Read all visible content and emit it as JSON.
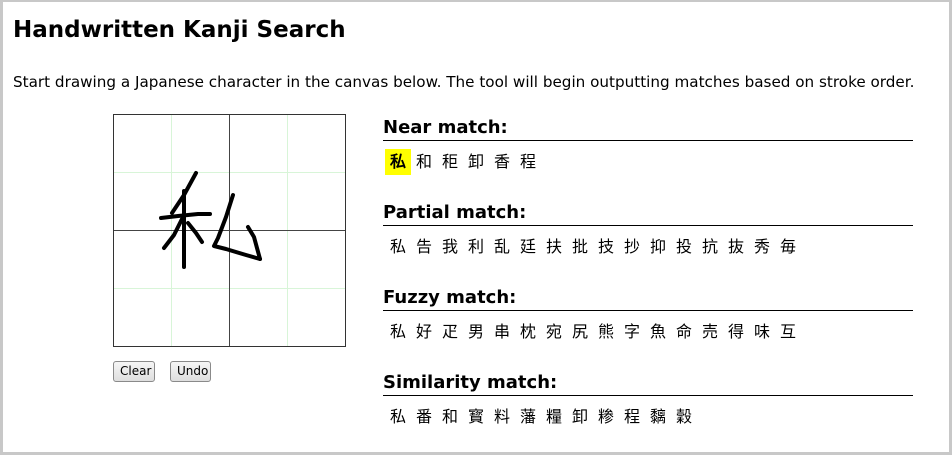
{
  "page": {
    "title": "Handwritten Kanji Search",
    "intro": "Start drawing a Japanese character in the canvas below. The tool will begin outputting matches based on stroke order."
  },
  "buttons": {
    "clear": "Clear",
    "undo": "Undo"
  },
  "sections": {
    "near": {
      "title": "Near match:",
      "kanji": [
        "私",
        "和",
        "秬",
        "卸",
        "香",
        "程"
      ],
      "highlighted_index": 0
    },
    "partial": {
      "title": "Partial match:",
      "kanji": [
        "私",
        "告",
        "我",
        "利",
        "乱",
        "廷",
        "扶",
        "批",
        "技",
        "抄",
        "抑",
        "投",
        "抗",
        "抜",
        "秀",
        "毎"
      ]
    },
    "fuzzy": {
      "title": "Fuzzy match:",
      "kanji": [
        "私",
        "好",
        "疋",
        "男",
        "串",
        "枕",
        "宛",
        "尻",
        "熊",
        "字",
        "魚",
        "命",
        "売",
        "得",
        "味",
        "互"
      ]
    },
    "similar": {
      "title": "Similarity match:",
      "kanji": [
        "私",
        "番",
        "和",
        "寳",
        "料",
        "藩",
        "糧",
        "卸",
        "糁",
        "程",
        "黐",
        "穀"
      ]
    }
  },
  "colors": {
    "highlight": "#ffff00",
    "grid_minor": "#d8f5d8",
    "grid_major": "#333333"
  }
}
